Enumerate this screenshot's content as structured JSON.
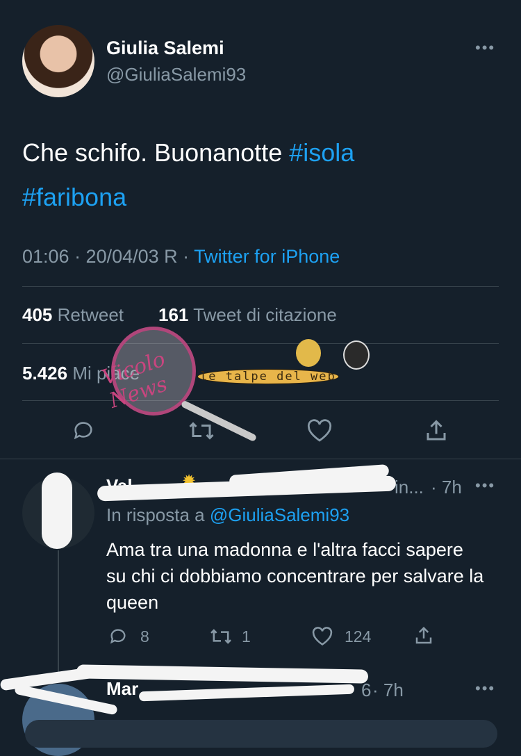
{
  "tweet": {
    "author_name": "Giulia Salemi",
    "author_handle": "@GiuliaSalemi93",
    "text_plain": "Che schifo. Buonanotte ",
    "hashtag1": "#isola",
    "hashtag2": "#faribona",
    "time": "01:06 · 20/04/03 R · ",
    "source": "Twitter for iPhone",
    "retweets_count": "405",
    "retweets_label": "Retweet",
    "quotes_count": "161",
    "quotes_label": "Tweet di citazione",
    "likes_count": "5.426",
    "likes_label": "Mi piace"
  },
  "reply1": {
    "name_visible": "Val",
    "handle_tail": "in...",
    "time": "· 7h",
    "reply_prefix": "In risposta a ",
    "reply_to": "@GiuliaSalemi93",
    "text": "Ama tra una madonna e l'altra facci sapere su chi ci dobbiamo concentrare per salvare la queen",
    "replies": "8",
    "retweets": "1",
    "likes": "124"
  },
  "reply2": {
    "name_visible": "Mar",
    "handle_tail": "6",
    "time": "· 7h"
  },
  "watermark": {
    "left": "Vicolo News",
    "right": "le talpe del web"
  }
}
